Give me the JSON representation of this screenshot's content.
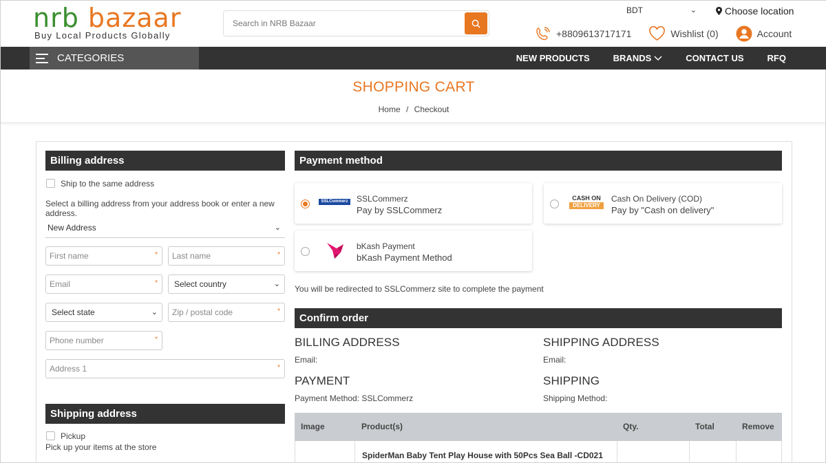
{
  "header": {
    "logo_nrb": "nrb",
    "logo_bazaar": "bazaar",
    "logo_tagline": "Buy Local Products Globally",
    "search_placeholder": "Search in NRB Bazaar",
    "currency": "BDT",
    "location": "Choose location",
    "phone": "+8809613717171",
    "wishlist": "Wishlist (0)",
    "account": "Account"
  },
  "nav": {
    "categories": "CATEGORIES",
    "links": [
      "NEW PRODUCTS",
      "BRANDS",
      "CONTACT US",
      "RFQ"
    ]
  },
  "page": {
    "title": "SHOPPING CART",
    "breadcrumb_home": "Home",
    "breadcrumb_sep": "/",
    "breadcrumb_current": "Checkout"
  },
  "billing": {
    "heading": "Billing address",
    "ship_same": "Ship to the same address",
    "instruction": "Select a billing address from your address book or enter a new address.",
    "address_select": "New Address",
    "first_name": "First name",
    "last_name": "Last name",
    "email": "Email",
    "country": "Select country",
    "state": "Select state",
    "zip": "Zip / postal code",
    "phone": "Phone number",
    "address1": "Address 1",
    "required_mark": "*"
  },
  "shipping": {
    "heading": "Shipping address",
    "pickup": "Pickup",
    "pickup_desc": "Pick up your items at the store"
  },
  "payment": {
    "heading": "Payment method",
    "methods": [
      {
        "name": "SSLCommerz",
        "desc": "Pay by SSLCommerz",
        "selected": true,
        "logo": "SSLCommerz"
      },
      {
        "name": "Cash On Delivery (COD)",
        "desc": "Pay by \"Cash on delivery\"",
        "selected": false,
        "logo_top": "CASH ON",
        "logo_bottom": "DELIVERY"
      },
      {
        "name": "bKash Payment",
        "desc": "bKash Payment Method",
        "selected": false
      }
    ],
    "redirect_note": "You will be redirected to SSLCommerz site to complete the payment"
  },
  "confirm": {
    "heading": "Confirm order",
    "billing_title": "BILLING ADDRESS",
    "billing_email": "Email:",
    "shipping_title": "SHIPPING ADDRESS",
    "shipping_email": "Email:",
    "payment_title": "PAYMENT",
    "payment_method": "Payment Method: SSLCommerz",
    "shipping_method_title": "SHIPPING",
    "shipping_method": "Shipping Method:"
  },
  "table": {
    "headers": [
      "Image",
      "Product(s)",
      "Qty.",
      "Total",
      "Remove"
    ],
    "rows": [
      {
        "product": "SpiderMan Baby Tent Play House with 50Pcs Sea Ball -CD021"
      }
    ]
  },
  "colors": {
    "accent": "#e87722",
    "brand_green": "#3a8f2f",
    "nav_bg": "#333333",
    "table_header": "#c9ccd0"
  }
}
